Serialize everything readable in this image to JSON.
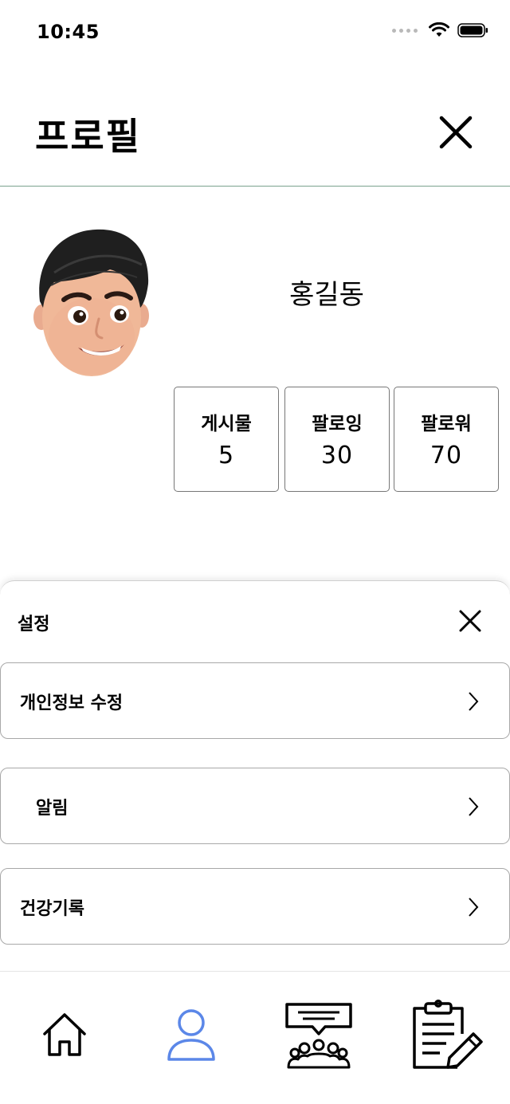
{
  "status_bar": {
    "time": "10:45"
  },
  "header": {
    "title": "프로필",
    "close_icon": "close-icon"
  },
  "profile": {
    "name": "홍길동",
    "avatar_icon": "memoji-avatar",
    "stats": [
      {
        "label": "게시물",
        "value": "5"
      },
      {
        "label": "팔로잉",
        "value": "30"
      },
      {
        "label": "팔로워",
        "value": "70"
      }
    ]
  },
  "settings": {
    "title": "설정",
    "items": [
      {
        "label": "개인정보 수정",
        "icon": "chevron-right-icon"
      },
      {
        "label": "알림",
        "icon": "chevron-right-icon"
      },
      {
        "label": "건강기록",
        "icon": "chevron-right-icon"
      }
    ]
  },
  "tabbar": {
    "tabs": [
      {
        "icon": "home-icon",
        "active": false
      },
      {
        "icon": "person-icon",
        "active": true
      },
      {
        "icon": "community-chat-icon",
        "active": false
      },
      {
        "icon": "clipboard-edit-icon",
        "active": false
      }
    ],
    "active_color": "#5b87e8",
    "inactive_color": "#000000"
  }
}
